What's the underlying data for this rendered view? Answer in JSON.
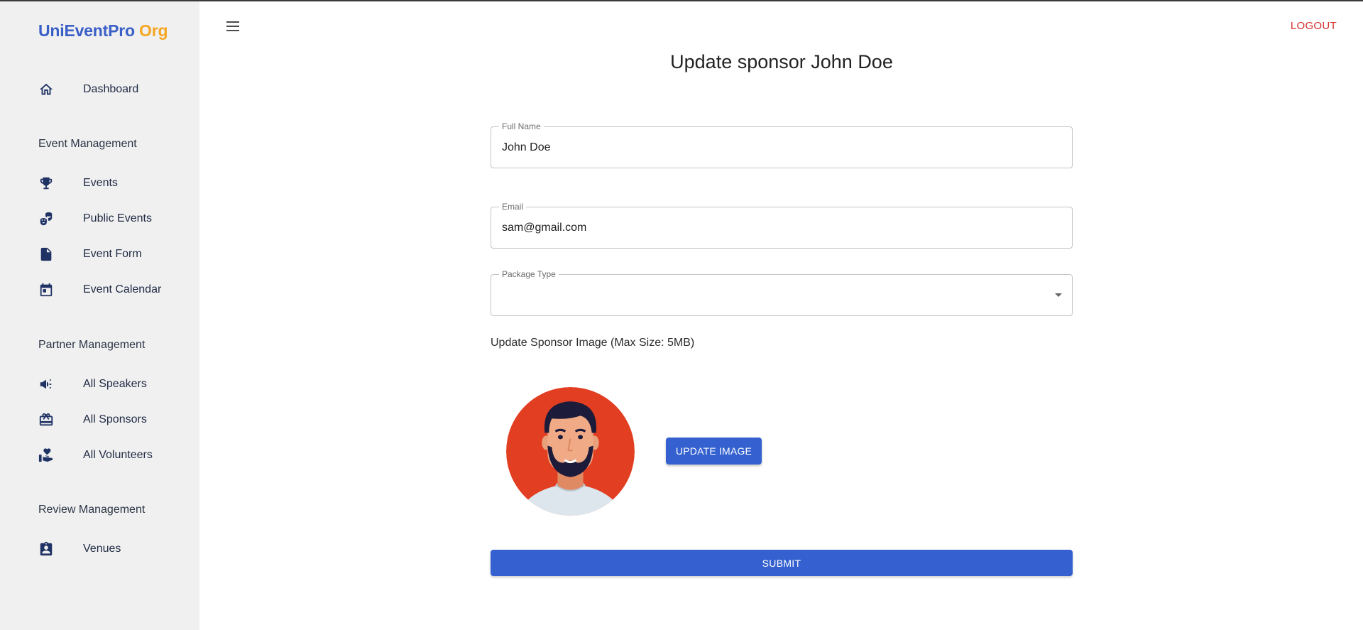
{
  "brand": {
    "name": "UniEventPro",
    "suffix": "Org"
  },
  "sidebar": {
    "items": [
      {
        "label": "Dashboard",
        "icon": "home-icon"
      },
      {
        "label": "Events",
        "icon": "trophy-icon"
      },
      {
        "label": "Public Events",
        "icon": "theater-masks-icon"
      },
      {
        "label": "Event Form",
        "icon": "file-icon"
      },
      {
        "label": "Event Calendar",
        "icon": "calendar-icon"
      },
      {
        "label": "All Speakers",
        "icon": "megaphone-icon"
      },
      {
        "label": "All Sponsors",
        "icon": "gift-card-icon"
      },
      {
        "label": "All Volunteers",
        "icon": "hand-heart-icon"
      },
      {
        "label": "Venues",
        "icon": "badge-icon"
      }
    ],
    "sections": [
      {
        "title": "Event Management"
      },
      {
        "title": "Partner Management"
      },
      {
        "title": "Review Management"
      }
    ]
  },
  "header": {
    "logout_label": "LOGOUT",
    "menu_icon": "hamburger-menu-icon"
  },
  "form": {
    "title": "Update sponsor John Doe",
    "full_name": {
      "label": "Full Name",
      "value": "John Doe"
    },
    "email": {
      "label": "Email",
      "value": "sam@gmail.com"
    },
    "package_type": {
      "label": "Package Type",
      "value": ""
    },
    "image_label": "Update Sponsor Image (Max Size: 5MB)",
    "update_image_label": "UPDATE IMAGE",
    "submit_label": "SUBMIT"
  },
  "colors": {
    "primary": "#3461cf",
    "brand_blue": "#3a5fc7",
    "brand_orange": "#f5a623",
    "logout_red": "#d32f2f",
    "sidebar_bg": "#f0f0f0"
  }
}
